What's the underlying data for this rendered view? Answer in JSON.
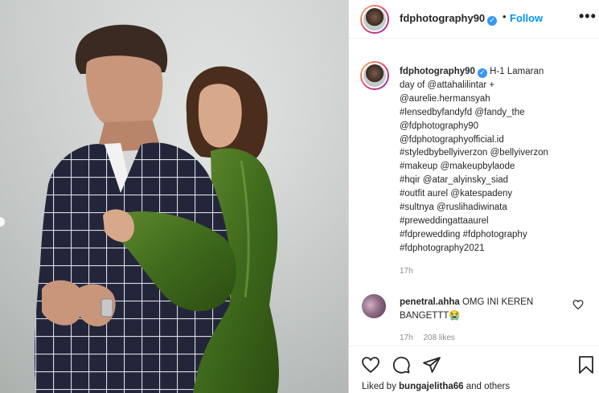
{
  "post": {
    "username": "fdphotography90",
    "dot": "•",
    "follow_label": "Follow",
    "more_label": "•••"
  },
  "caption": {
    "username": "fdphotography90",
    "lines": [
      "H-1 Lamaran",
      "day of @attahalilintar +",
      "@aurelie.hermansyah",
      "#lensedbyfandyfd @fandy_the",
      "@fdphotography90",
      "@fdphotographyofficial.id",
      "#styledbybellyiverzon @bellyiverzon",
      "#makeup @makeupbylaode",
      "#hqir @atar_alyinsky_siad",
      "#outfit aurel @katespadeny",
      "#sultnya @ruslihadiwinata",
      "#preweddingattaaurel",
      "#fdprewedding #fdphotography",
      "#fdphotography2021"
    ],
    "time": "17h"
  },
  "comment": {
    "username": "penetral.ahha",
    "text": "OMG INI KEREN BANGETTT😭",
    "time": "17h",
    "likes": "208 likes"
  },
  "likes_line": {
    "prefix": "Liked by ",
    "username": "bungajelitha66",
    "suffix": " and others"
  },
  "icons": {
    "like": "heart-icon",
    "comment": "comment-icon",
    "share": "share-icon",
    "save": "bookmark-icon",
    "verified": "verified-badge-icon"
  },
  "colors": {
    "follow": "#0095f6",
    "verified": "#3897f0",
    "muted": "#8e8e8e"
  }
}
